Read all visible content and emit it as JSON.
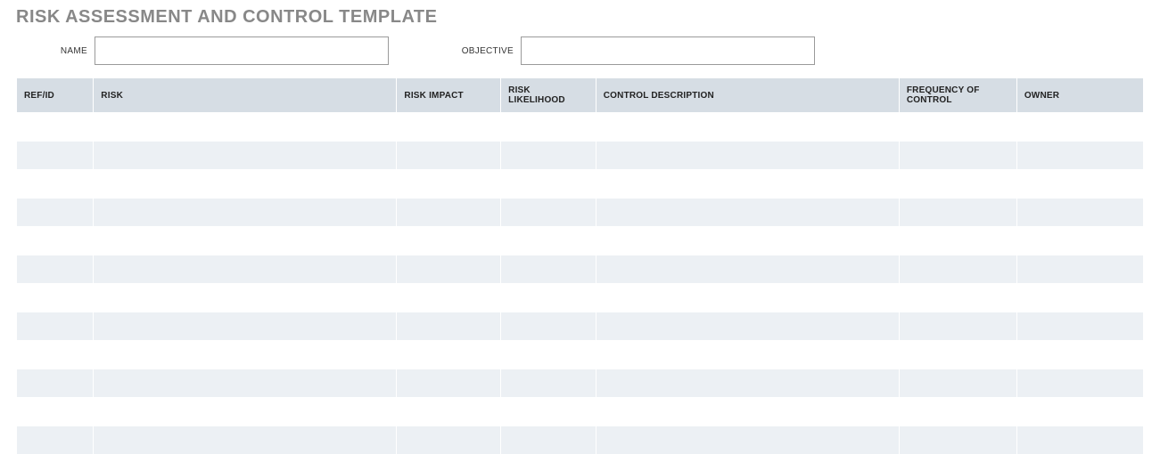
{
  "title": "RISK ASSESSMENT AND CONTROL TEMPLATE",
  "fields": {
    "name_label": "NAME",
    "name_value": "",
    "objective_label": "OBJECTIVE",
    "objective_value": ""
  },
  "table": {
    "headers": {
      "refid": "REF/ID",
      "risk": "RISK",
      "impact": "RISK IMPACT",
      "likelihood": "RISK LIKELIHOOD",
      "control": "CONTROL DESCRIPTION",
      "frequency": "FREQUENCY OF CONTROL",
      "owner": "OWNER"
    },
    "rows": [
      {
        "refid": "",
        "risk": "",
        "impact": "",
        "likelihood": "",
        "control": "",
        "frequency": "",
        "owner": ""
      },
      {
        "refid": "",
        "risk": "",
        "impact": "",
        "likelihood": "",
        "control": "",
        "frequency": "",
        "owner": ""
      },
      {
        "refid": "",
        "risk": "",
        "impact": "",
        "likelihood": "",
        "control": "",
        "frequency": "",
        "owner": ""
      },
      {
        "refid": "",
        "risk": "",
        "impact": "",
        "likelihood": "",
        "control": "",
        "frequency": "",
        "owner": ""
      },
      {
        "refid": "",
        "risk": "",
        "impact": "",
        "likelihood": "",
        "control": "",
        "frequency": "",
        "owner": ""
      },
      {
        "refid": "",
        "risk": "",
        "impact": "",
        "likelihood": "",
        "control": "",
        "frequency": "",
        "owner": ""
      },
      {
        "refid": "",
        "risk": "",
        "impact": "",
        "likelihood": "",
        "control": "",
        "frequency": "",
        "owner": ""
      },
      {
        "refid": "",
        "risk": "",
        "impact": "",
        "likelihood": "",
        "control": "",
        "frequency": "",
        "owner": ""
      },
      {
        "refid": "",
        "risk": "",
        "impact": "",
        "likelihood": "",
        "control": "",
        "frequency": "",
        "owner": ""
      },
      {
        "refid": "",
        "risk": "",
        "impact": "",
        "likelihood": "",
        "control": "",
        "frequency": "",
        "owner": ""
      },
      {
        "refid": "",
        "risk": "",
        "impact": "",
        "likelihood": "",
        "control": "",
        "frequency": "",
        "owner": ""
      },
      {
        "refid": "",
        "risk": "",
        "impact": "",
        "likelihood": "",
        "control": "",
        "frequency": "",
        "owner": ""
      }
    ]
  }
}
